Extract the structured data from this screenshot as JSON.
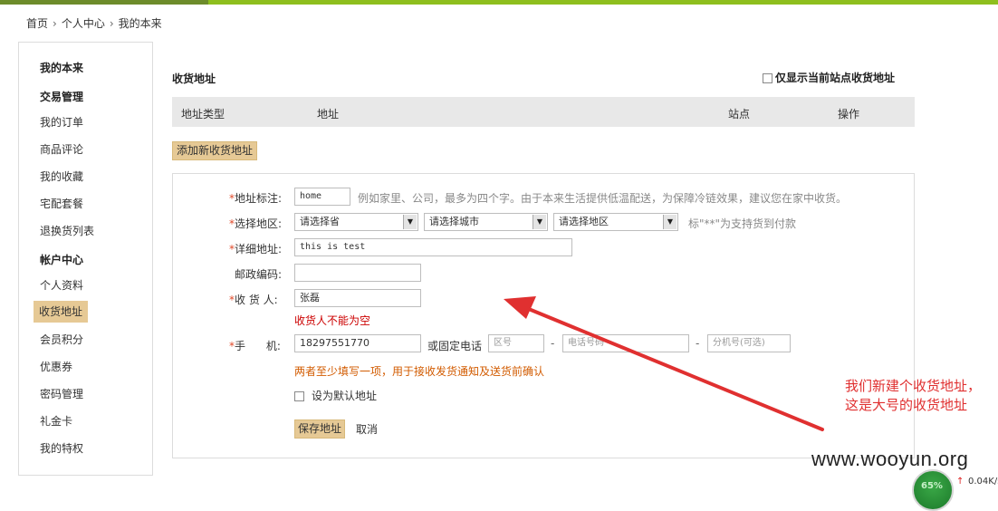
{
  "breadcrumb": [
    "首页",
    "个人中心",
    "我的本来"
  ],
  "sidebar": {
    "heading": "我的本来",
    "group1": "交易管理",
    "items1": [
      "我的订单",
      "商品评论",
      "我的收藏",
      "宅配套餐",
      "退换货列表"
    ],
    "group2": "帐户中心",
    "items2": [
      "个人资料",
      "收货地址",
      "会员积分",
      "优惠券",
      "密码管理",
      "礼金卡",
      "我的特权"
    ],
    "active": "收货地址"
  },
  "main": {
    "title": "收货地址",
    "only_current": "仅显示当前站点收货地址",
    "table_headers": [
      "地址类型",
      "地址",
      "站点",
      "操作"
    ],
    "add_button": "添加新收货地址"
  },
  "form": {
    "tag_label": "地址标注:",
    "tag_value": "home",
    "tag_hint": "例如家里、公司，最多为四个字。由于本来生活提供低温配送，为保障冷链效果，建议您在家中收货。",
    "region_label": "选择地区:",
    "province": "请选择省",
    "city": "请选择城市",
    "district": "请选择地区",
    "region_hint": "标\"**\"为支持货到付款",
    "detail_label": "详细地址:",
    "detail_value": "this is test",
    "zip_label": "邮政编码:",
    "zip_value": "",
    "receiver_label": "收 货 人:",
    "receiver_value": "张磊",
    "receiver_error": "收货人不能为空",
    "mobile_label": "手      机:",
    "mobile_value": "18297551770",
    "or_phone": "或固定电话",
    "area_code_placeholder": "区号",
    "phone_placeholder": "电话号码",
    "ext_placeholder": "分机号(可选)",
    "phone_tip": "两者至少填写一项，用于接收发货通知及送货前确认",
    "default_label": "设为默认地址",
    "save_button": "保存地址",
    "cancel_button": "取消",
    "required_mark": "*"
  },
  "annotation": {
    "line1": "我们新建个收货地址，",
    "line2": "这是大号的收货地址"
  },
  "watermark": "www.wooyun.org",
  "speed_widget": {
    "percent": "65%",
    "net_rate": "0.04K/s",
    "up_arrow": "↑"
  },
  "colors": {
    "accent_green": "#8ebf1e",
    "button_tan": "#e6c995",
    "error_red": "#cc0000",
    "tip_orange": "#d25b00",
    "annotation_red": "#e03030"
  }
}
